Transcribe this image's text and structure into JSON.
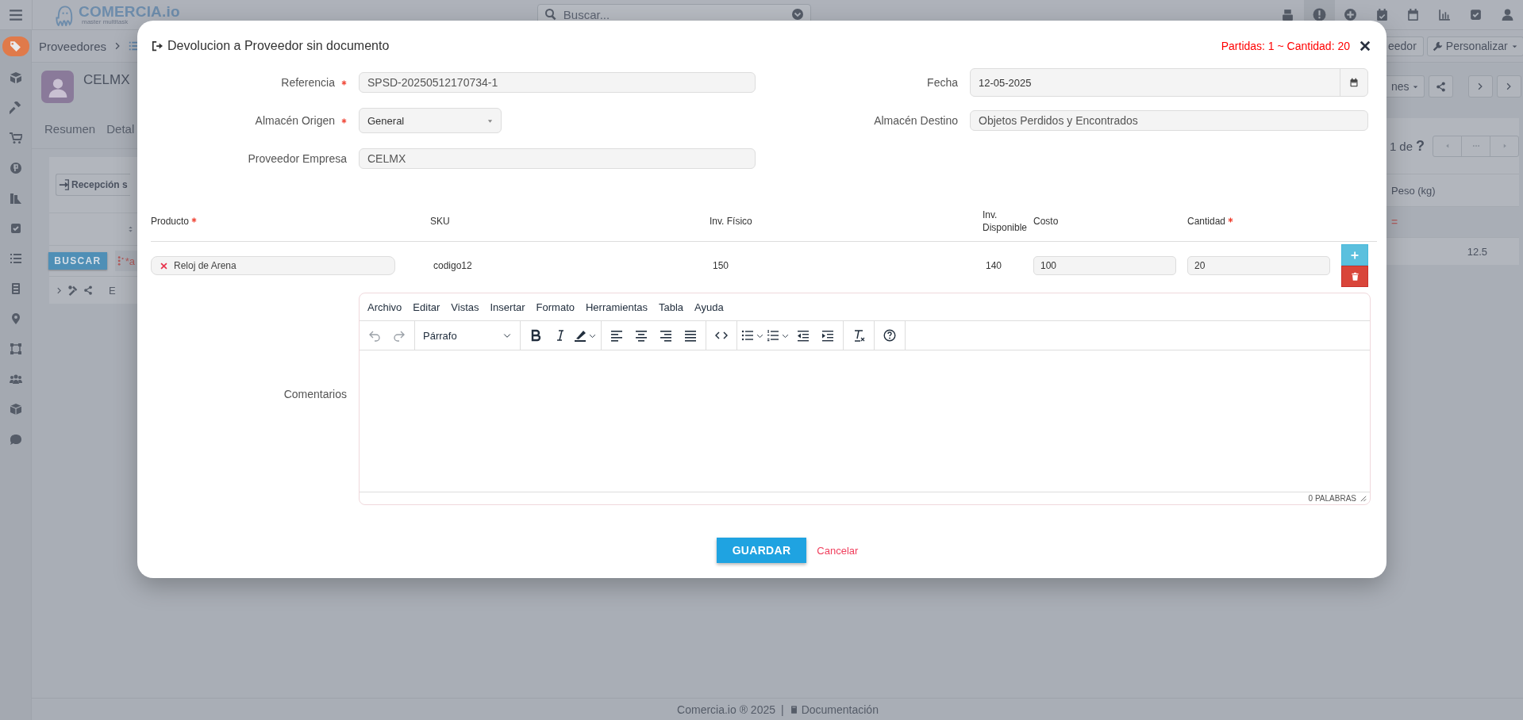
{
  "topbar": {
    "logo": "COMERCIA.io",
    "tagline": "master multitask",
    "search": {
      "placeholder": "Buscar..."
    }
  },
  "breadcrumb": {
    "items": [
      "Proveedores"
    ]
  },
  "header_buttons": [
    "eedor",
    "Personalizar"
  ],
  "profile": {
    "name": "CELMX",
    "tabs": [
      {
        "label": "Resumen",
        "selected": false
      },
      {
        "label": "Detal",
        "selected": false
      }
    ],
    "menu_button": "nes"
  },
  "list_panel": {
    "action_button": "Recepción s",
    "pager": {
      "page": "1",
      "of": "de",
      "total": "?"
    },
    "column_header": "Peso (kg)",
    "search_button": "BUSCAR",
    "filter_text": "*a",
    "filter_value": "=",
    "row": {
      "column_1": "E",
      "weight": "12.5"
    }
  },
  "modal": {
    "title": "Devolucion a Proveedor sin documento",
    "summary": "Partidas: 1 ~ Cantidad: 20",
    "fields": [
      {
        "label": "Referencia",
        "required": true,
        "kind": "text",
        "value": "SPSD-20250512170734-1"
      },
      {
        "label": "Fecha",
        "required": false,
        "kind": "date",
        "value": "12-05-2025"
      },
      {
        "label": "Almacén Origen",
        "required": true,
        "kind": "select",
        "value": "General"
      },
      {
        "label": "Almacén Destino",
        "required": false,
        "kind": "text",
        "value": "Objetos Perdidos y Encontrados"
      },
      {
        "label": "Proveedor Empresa",
        "required": false,
        "kind": "text",
        "value": "CELMX"
      }
    ],
    "table": {
      "columns": [
        {
          "label": "Producto",
          "required": true
        },
        {
          "label": "SKU",
          "required": false
        },
        {
          "label": "Inv. Físico",
          "required": false
        },
        {
          "label": "Inv. Disponible",
          "required": false
        },
        {
          "label": "Costo",
          "required": false
        },
        {
          "label": "Cantidad",
          "required": true
        }
      ],
      "rows": [
        {
          "product": "Reloj de Arena",
          "sku": "codigo12",
          "physical": "150",
          "available": "140",
          "cost": "100",
          "quantity": "20"
        }
      ]
    },
    "comments": {
      "label": "Comentarios",
      "menu": [
        "Archivo",
        "Editar",
        "Vistas",
        "Insertar",
        "Formato",
        "Herramientas",
        "Tabla",
        "Ayuda"
      ],
      "block_format": "Párrafo",
      "word_count": "0 PALABRAS"
    },
    "save_button": "GUARDAR",
    "cancel_link": "Cancelar"
  },
  "footer": {
    "copyright": "Comercia.io ® 2025",
    "separator": "|",
    "doc_link": "Documentación"
  }
}
